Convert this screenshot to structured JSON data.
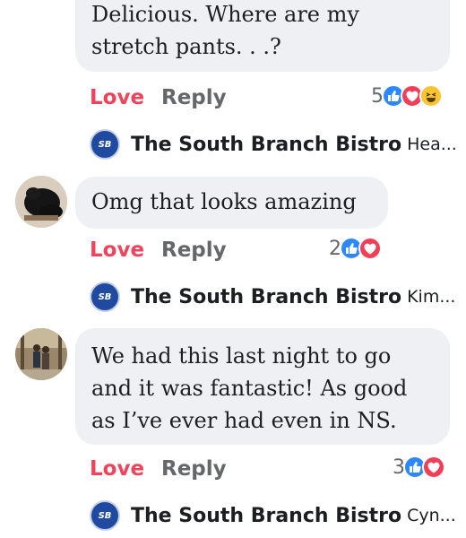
{
  "comments": [
    {
      "lines": [
        "Delicious.  Where are my",
        "stretch pants. . .?"
      ],
      "love": "Love",
      "reply": "Reply",
      "count": "5",
      "reactions": [
        "like",
        "heart",
        "haha"
      ],
      "reply_page": "The South Branch Bistro",
      "reply_preview": "Hea...",
      "logo_text": "SB"
    },
    {
      "lines": [
        "Omg that looks amazing"
      ],
      "love": "Love",
      "reply": "Reply",
      "count": "2",
      "reactions": [
        "like",
        "heart"
      ],
      "reply_page": "The South Branch Bistro",
      "reply_preview": "Kim...",
      "logo_text": "SB"
    },
    {
      "lines": [
        "We had this last night to go",
        "and it was fantastic! As good",
        "as I’ve ever had even in NS."
      ],
      "love": "Love",
      "reply": "Reply",
      "count": "3",
      "reactions": [
        "like",
        "heart"
      ],
      "reply_page": "The South Branch Bistro",
      "reply_preview": "Cyn...",
      "logo_text": "SB"
    }
  ],
  "colors": {
    "love": "#f0445c",
    "reply": "#65676b",
    "bubble": "#eff0f3",
    "like": "#2d88ff",
    "heart": "#f33e58",
    "haha": "#f7c531"
  }
}
